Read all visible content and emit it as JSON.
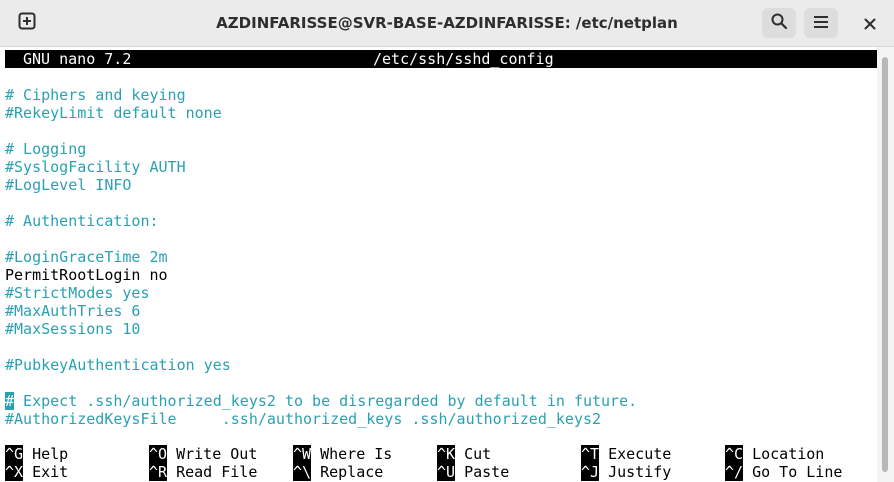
{
  "window": {
    "title": "AZDINFARISSE@SVR-BASE-AZDINFARISSE: /etc/netplan"
  },
  "titlebar_icons": {
    "new_tab": "new-tab-icon",
    "search": "search-icon",
    "menu": "hamburger-menu-icon",
    "close": "close-icon"
  },
  "nano": {
    "version": "GNU nano 7.2",
    "filename": "/etc/ssh/sshd_config"
  },
  "lines": [
    {
      "text": "# Ciphers and keying",
      "style": "comment"
    },
    {
      "text": "#RekeyLimit default none",
      "style": "comment"
    },
    {
      "text": "",
      "style": "comment"
    },
    {
      "text": "# Logging",
      "style": "comment"
    },
    {
      "text": "#SyslogFacility AUTH",
      "style": "comment"
    },
    {
      "text": "#LogLevel INFO",
      "style": "comment"
    },
    {
      "text": "",
      "style": "comment"
    },
    {
      "text": "# Authentication:",
      "style": "comment"
    },
    {
      "text": "",
      "style": "comment"
    },
    {
      "text": "#LoginGraceTime 2m",
      "style": "comment"
    },
    {
      "text": "PermitRootLogin no",
      "style": "normal"
    },
    {
      "text": "#StrictModes yes",
      "style": "comment"
    },
    {
      "text": "#MaxAuthTries 6",
      "style": "comment"
    },
    {
      "text": "#MaxSessions 10",
      "style": "comment"
    },
    {
      "text": "",
      "style": "comment"
    },
    {
      "text": "#PubkeyAuthentication yes",
      "style": "comment"
    },
    {
      "text": "",
      "style": "comment"
    },
    {
      "text": "# Expect .ssh/authorized_keys2 to be disregarded by default in future.",
      "style": "comment"
    },
    {
      "text": "#AuthorizedKeysFile     .ssh/authorized_keys .ssh/authorized_keys2",
      "style": "comment"
    }
  ],
  "shortcuts": [
    {
      "key": "^G",
      "label": "Help"
    },
    {
      "key": "^O",
      "label": "Write Out"
    },
    {
      "key": "^W",
      "label": "Where Is"
    },
    {
      "key": "^K",
      "label": "Cut"
    },
    {
      "key": "^T",
      "label": "Execute"
    },
    {
      "key": "^C",
      "label": "Location"
    },
    {
      "key": "^X",
      "label": "Exit"
    },
    {
      "key": "^R",
      "label": "Read File"
    },
    {
      "key": "^\\",
      "label": "Replace"
    },
    {
      "key": "^U",
      "label": "Paste"
    },
    {
      "key": "^J",
      "label": "Justify"
    },
    {
      "key": "^/",
      "label": "Go To Line"
    }
  ],
  "colors": {
    "comment": "#2aa1b3",
    "text": "#000000",
    "header_bg": "#000000",
    "header_fg": "#ffffff",
    "cursor_bg": "#2aa1b3"
  }
}
